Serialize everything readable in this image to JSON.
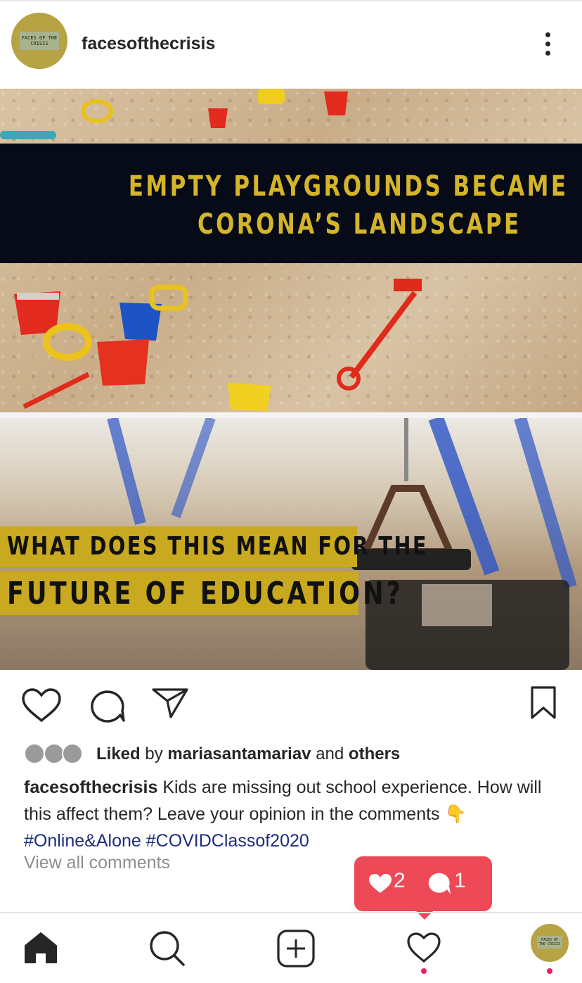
{
  "header": {
    "username": "facesofthecrisis",
    "avatar_text": "FACES OF THE CRISIS"
  },
  "post": {
    "banner_line1": "EMPTY PLAYGROUNDS BECAME",
    "banner_line2": "CORONA’S LANDSCAPE",
    "question_line1": "WHAT DOES THIS MEAN FOR THE",
    "question_line2": "FUTURE OF EDUCATION?"
  },
  "likes": {
    "liked_word": "Liked",
    "by_word": "by",
    "liker": "mariasantamariav",
    "and_word": "and",
    "others": "others"
  },
  "caption": {
    "username": "facesofthecrisis",
    "text": "Kids are missing out school experience. How will this affect them? Leave your opinion in the comments 👇",
    "tags": "#Online&Alone #COVIDClassof2020",
    "view_all": "View all comments"
  },
  "notification": {
    "likes_count": "2",
    "comments_count": "1"
  },
  "nav": {
    "avatar_text": "FACES OF THE CRISIS"
  },
  "colors": {
    "notification": "#ed4956",
    "banner_text": "#d4b52a",
    "hashtag": "#1e2d7d",
    "muted": "#8e8e8e"
  }
}
